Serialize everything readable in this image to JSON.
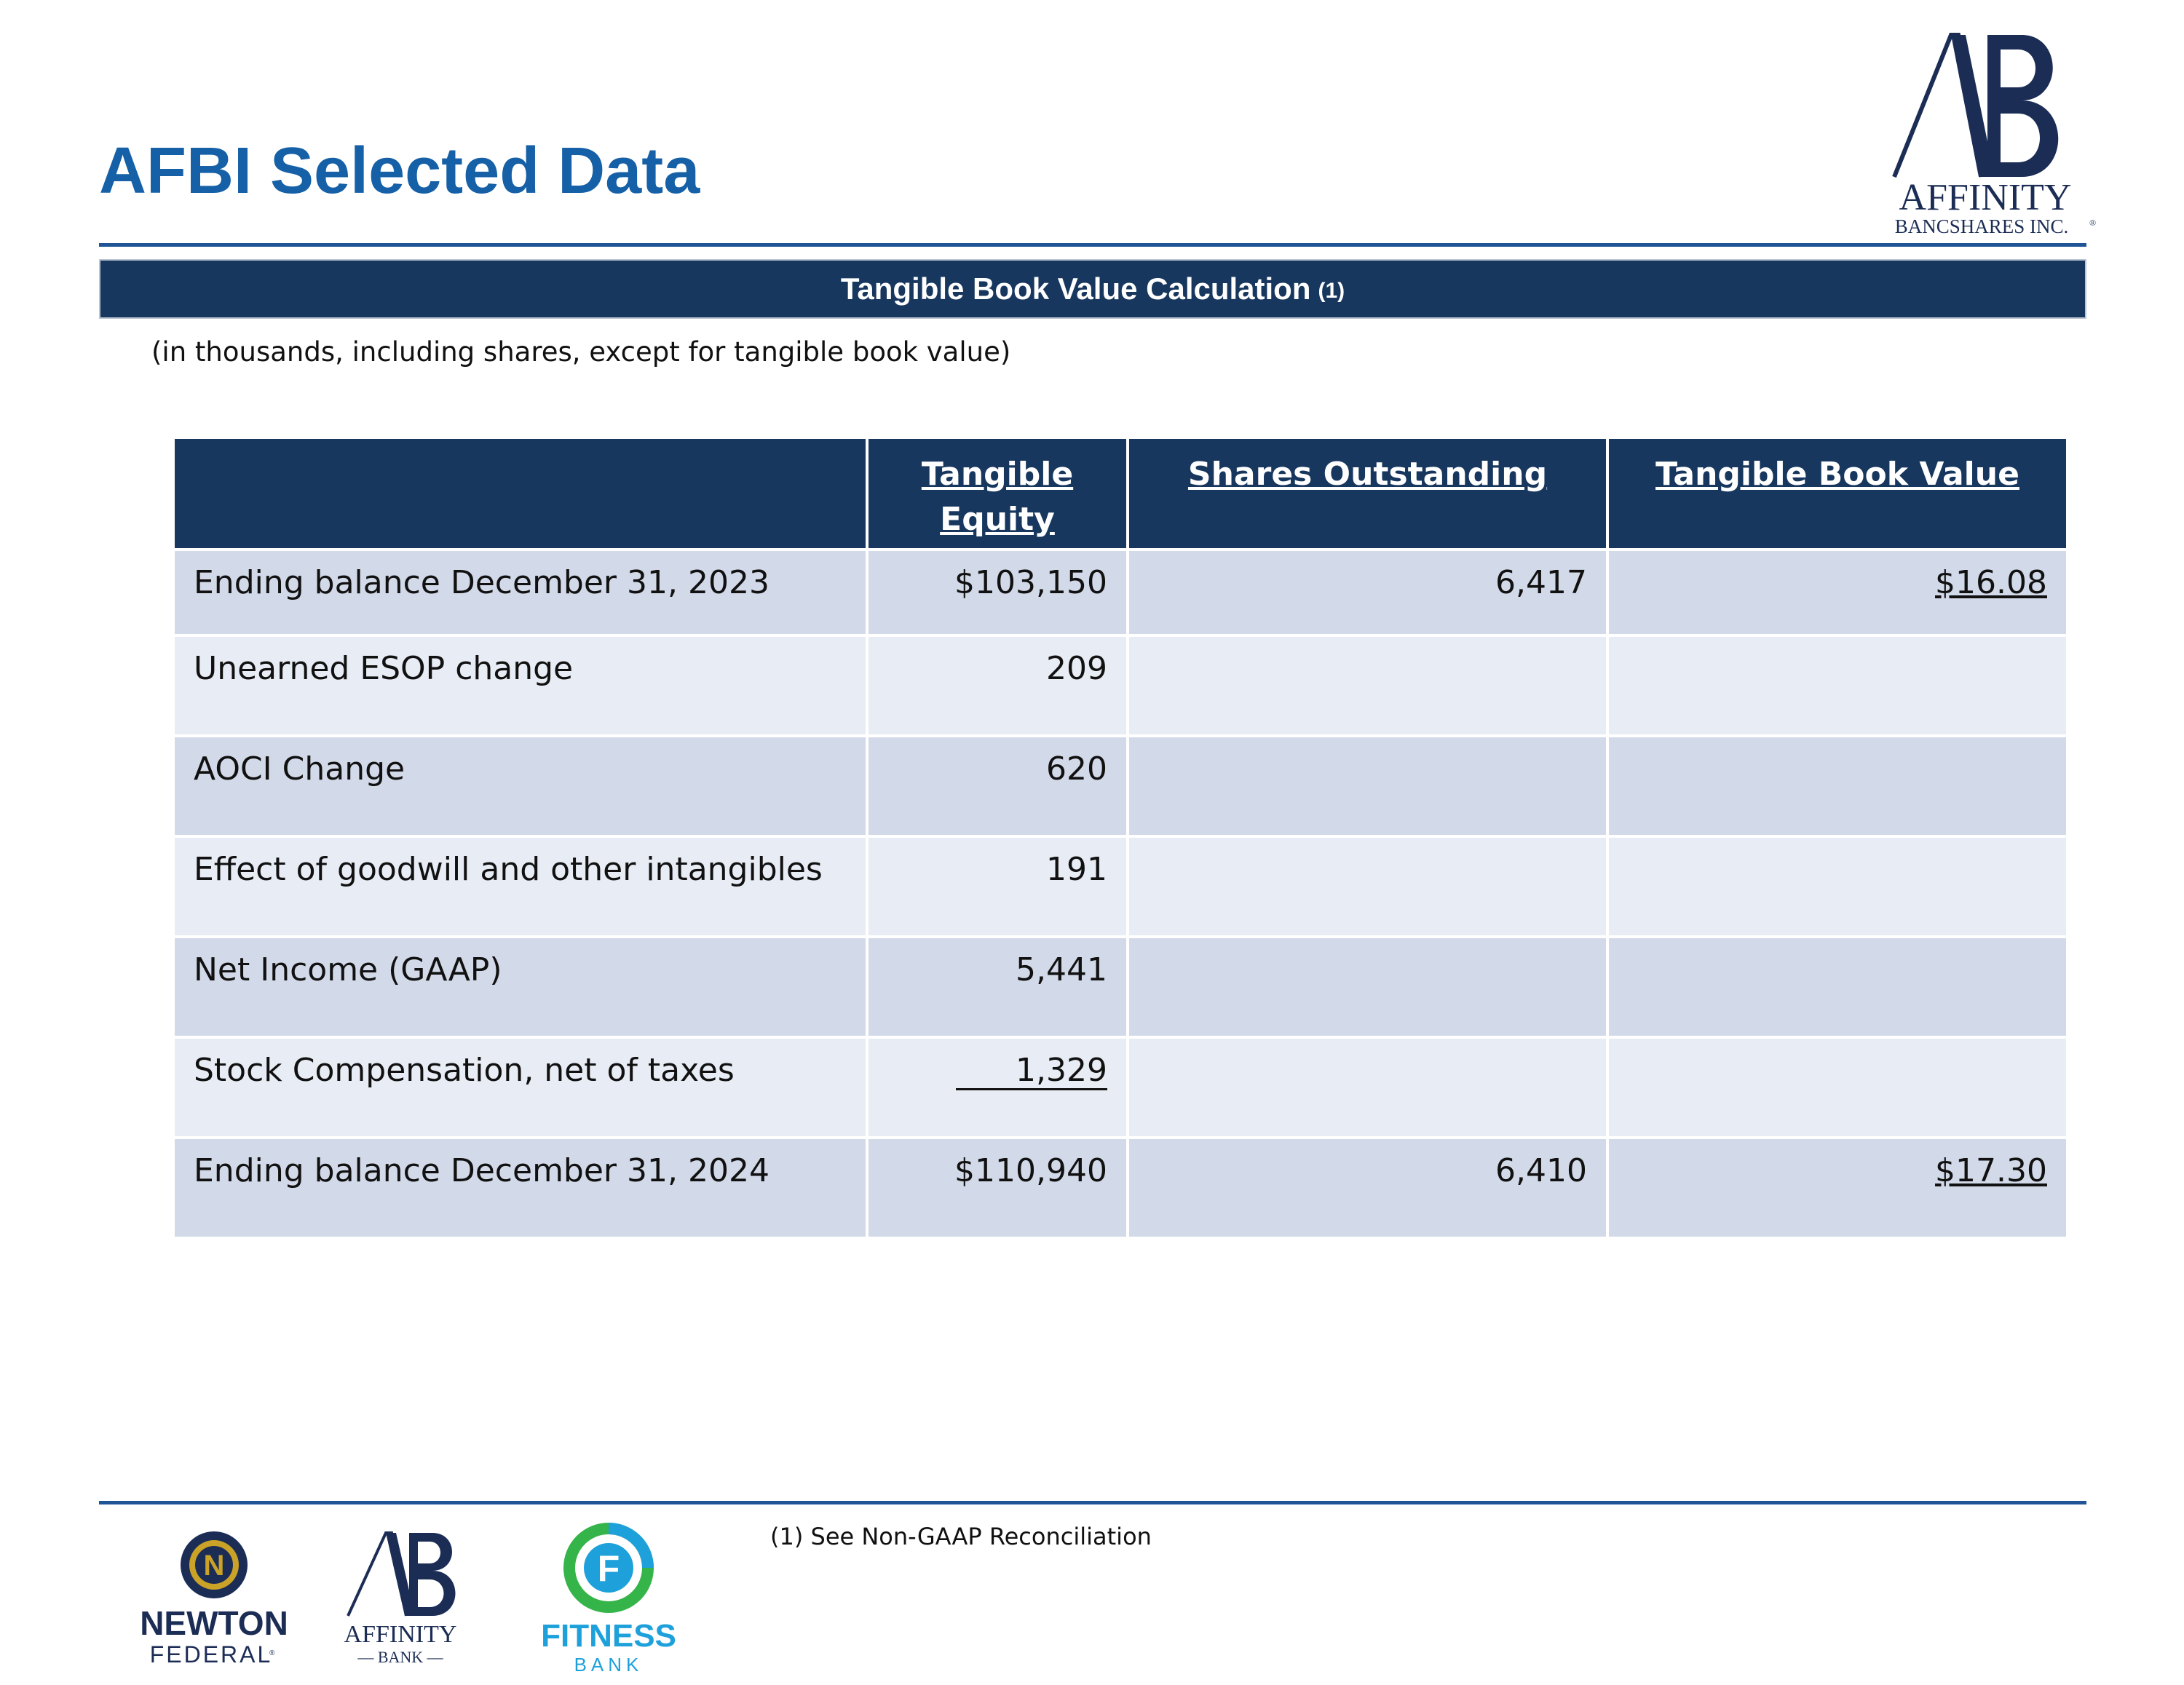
{
  "page": {
    "title": "AFBI Selected Data",
    "section_title": "Tangible Book Value Calculation",
    "section_note": "(1)",
    "units_note": "(in thousands, including shares, except for tangible book value)",
    "footnote": "(1) See Non-GAAP Reconciliation"
  },
  "logos": {
    "main": {
      "monogram": "AB",
      "name": "AFFINITY",
      "sub": "BANCSHARES INC.",
      "mark": "®"
    },
    "newton": {
      "letter": "N",
      "name": "NEWTON",
      "sub": "FEDERAL",
      "mark": "®"
    },
    "affinity_bank": {
      "monogram": "AB",
      "name": "AFFINITY",
      "sub": "— BANK —"
    },
    "fitness": {
      "letter": "F",
      "name": "FITNESS",
      "sub": "BANK"
    }
  },
  "colors": {
    "title_blue": "#1560a6",
    "header_navy": "#17375e",
    "row_dark": "#d2d9e8",
    "row_light": "#e8ecf4",
    "newton_gold": "#c9a227",
    "fitness_green": "#35b44a",
    "fitness_blue": "#1ea1db"
  },
  "table": {
    "headers": [
      "",
      "Tangible Equity",
      "Shares Outstanding",
      "Tangible Book Value"
    ],
    "rows": [
      {
        "label": "Ending balance December 31, 2023",
        "equity": "$103,150",
        "shares": "6,417",
        "tbv": "$16.08"
      },
      {
        "label": "Unearned ESOP change",
        "equity": "209",
        "shares": "",
        "tbv": ""
      },
      {
        "label": "AOCI Change",
        "equity": "620",
        "shares": "",
        "tbv": ""
      },
      {
        "label": "Effect of goodwill and other intangibles",
        "equity": "191",
        "shares": "",
        "tbv": ""
      },
      {
        "label": "Net Income (GAAP)",
        "equity": "5,441",
        "shares": "",
        "tbv": ""
      },
      {
        "label": "Stock Compensation, net of taxes",
        "equity": "1,329",
        "shares": "",
        "tbv": ""
      },
      {
        "label": "Ending balance December 31, 2024",
        "equity": "$110,940",
        "shares": "6,410",
        "tbv": "$17.30"
      }
    ]
  }
}
